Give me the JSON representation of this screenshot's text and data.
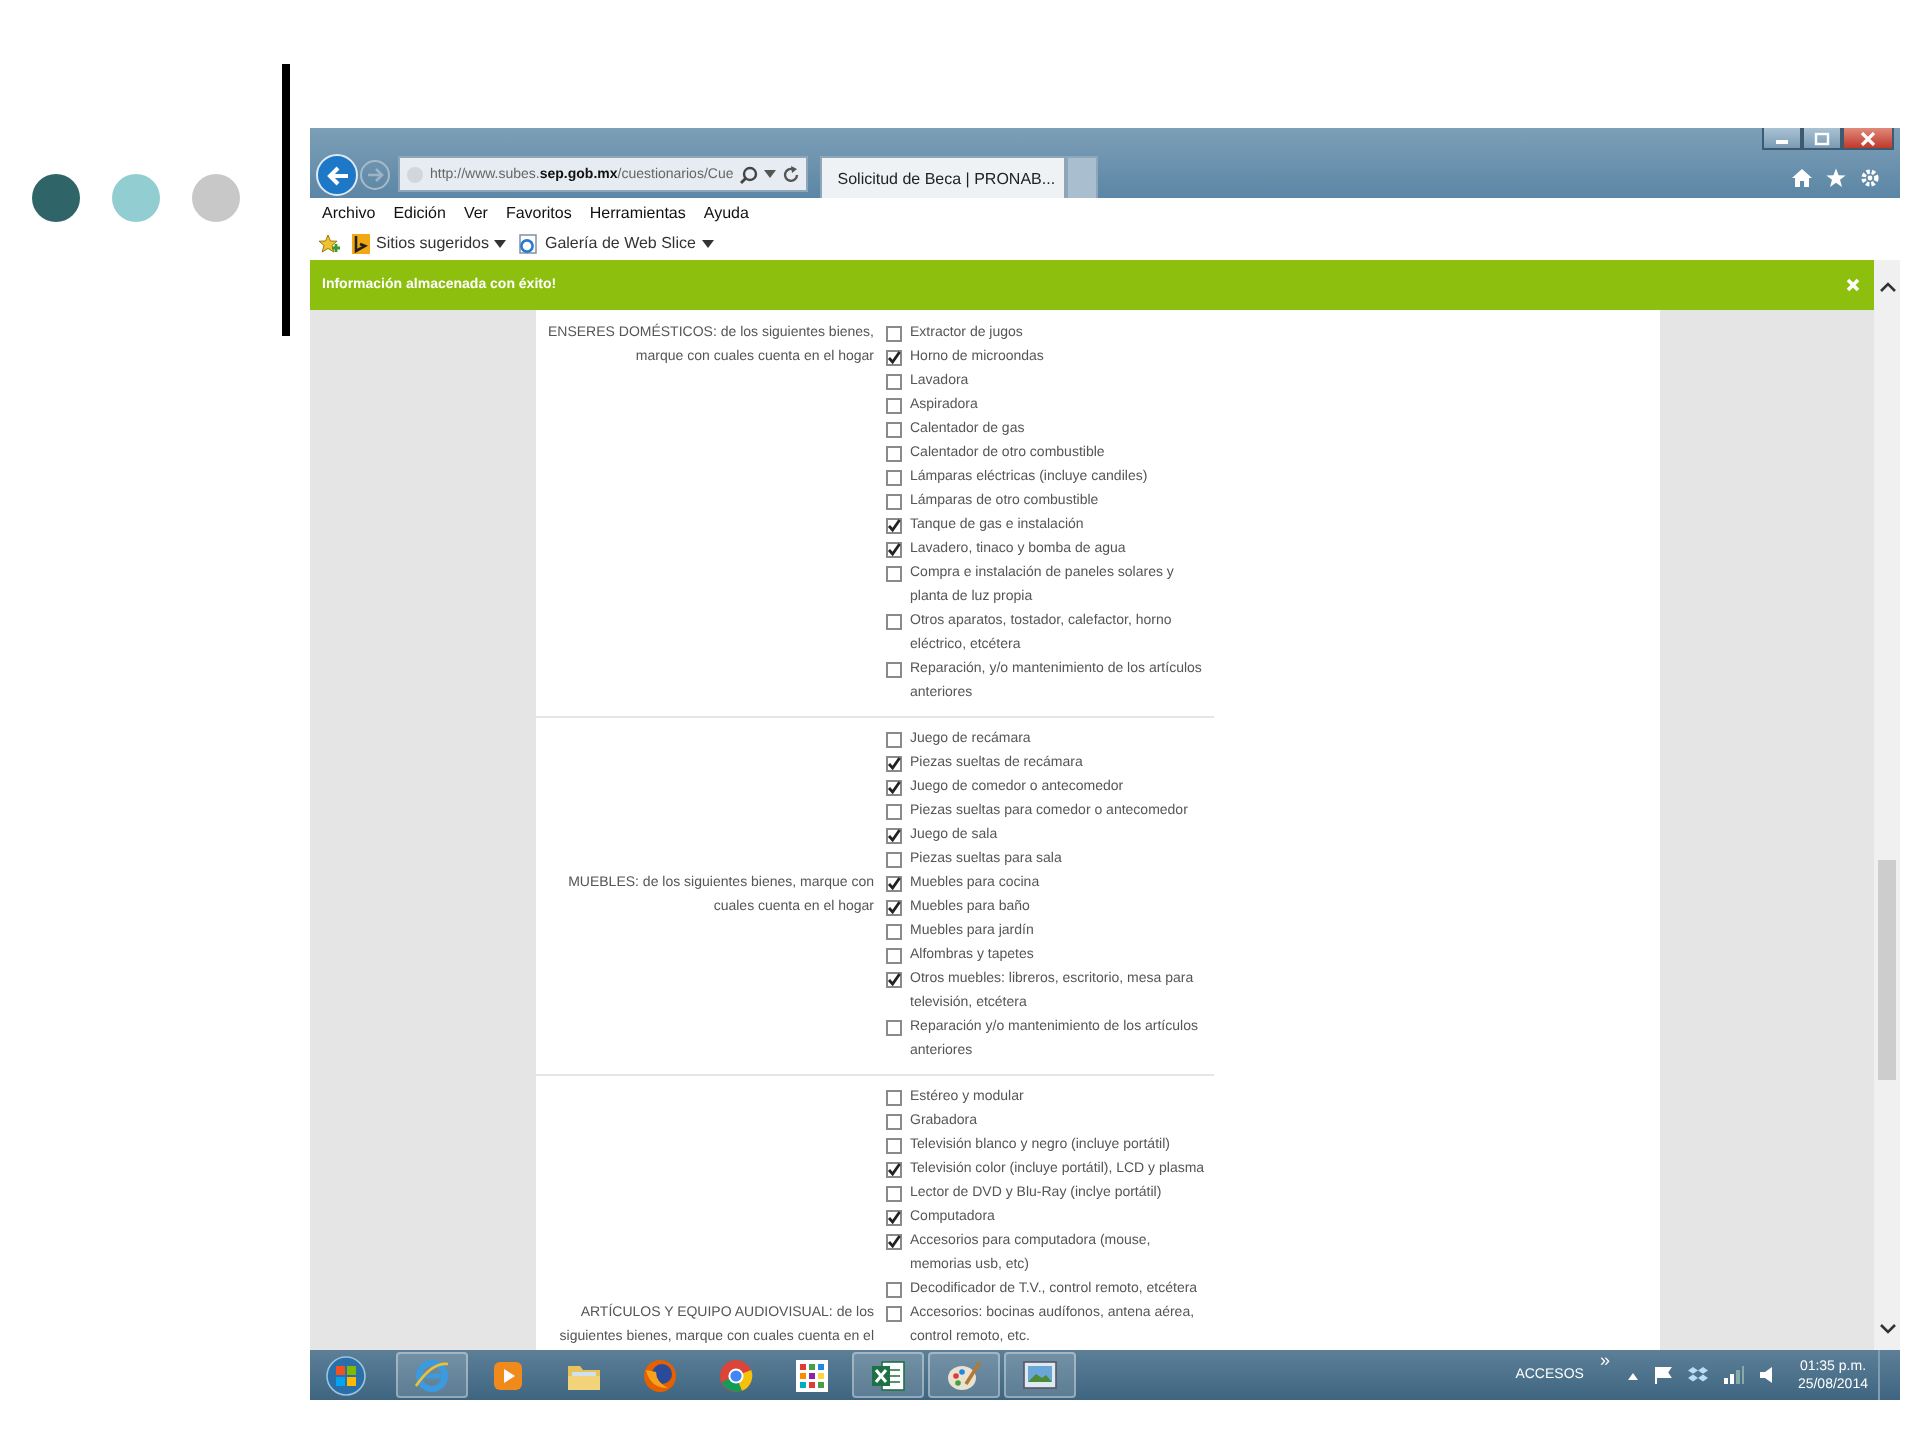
{
  "browser": {
    "address": "http://www.subes.**sep.gob.mx**/cuestionarios/Cue",
    "tabs": [
      {
        "title": "Solicitud de Beca | PRONAB...",
        "selected": true
      }
    ],
    "menu": [
      "Archivo",
      "Edición",
      "Ver",
      "Favoritos",
      "Herramientas",
      "Ayuda"
    ],
    "favorites": [
      {
        "kind": "suggested",
        "label": "Sitios sugeridos"
      },
      {
        "kind": "webslice",
        "label": "Galería de Web Slice"
      }
    ],
    "notification": {
      "text": "Información almacenada con éxito!"
    }
  },
  "form": {
    "sections": [
      {
        "label": "ENSERES DOMÉSTICOS: de los siguientes bienes, marque con cuales cuenta en el hogar",
        "items": [
          {
            "label": "Extractor de jugos",
            "checked": false
          },
          {
            "label": "Horno de microondas",
            "checked": true
          },
          {
            "label": "Lavadora",
            "checked": false
          },
          {
            "label": "Aspiradora",
            "checked": false
          },
          {
            "label": "Calentador de gas",
            "checked": false
          },
          {
            "label": "Calentador de otro combustible",
            "checked": false
          },
          {
            "label": "Lámparas eléctricas (incluye candiles)",
            "checked": false
          },
          {
            "label": "Lámparas de otro combustible",
            "checked": false
          },
          {
            "label": "Tanque de gas e instalación",
            "checked": true
          },
          {
            "label": "Lavadero, tinaco y bomba de agua",
            "checked": true
          },
          {
            "label": "Compra e instalación de paneles solares y planta de luz propia",
            "checked": false
          },
          {
            "label": "Otros aparatos, tostador, calefactor, horno eléctrico, etcétera",
            "checked": false
          },
          {
            "label": "Reparación, y/o mantenimiento de los artículos anteriores",
            "checked": false
          }
        ]
      },
      {
        "label": "MUEBLES: de los siguientes bienes, marque con cuales cuenta en el hogar",
        "items": [
          {
            "label": "Juego de recámara",
            "checked": false
          },
          {
            "label": "Piezas sueltas de recámara",
            "checked": true
          },
          {
            "label": "Juego de comedor o antecomedor",
            "checked": true
          },
          {
            "label": "Piezas sueltas para comedor o antecomedor",
            "checked": false
          },
          {
            "label": "Juego de sala",
            "checked": true
          },
          {
            "label": "Piezas sueltas para sala",
            "checked": false
          },
          {
            "label": "Muebles para cocina",
            "checked": true
          },
          {
            "label": "Muebles para baño",
            "checked": true
          },
          {
            "label": "Muebles para jardín",
            "checked": false
          },
          {
            "label": "Alfombras y tapetes",
            "checked": false
          },
          {
            "label": "Otros muebles: libreros, escritorio, mesa para televisión, etcétera",
            "checked": true
          },
          {
            "label": "Reparación y/o mantenimiento de los artículos anteriores",
            "checked": false
          }
        ]
      },
      {
        "label": "ARTÍCULOS Y EQUIPO AUDIOVISUAL: de los siguientes bienes, marque con cuales cuenta en el",
        "items": [
          {
            "label": "Estéreo y modular",
            "checked": false
          },
          {
            "label": "Grabadora",
            "checked": false
          },
          {
            "label": "Televisión blanco y negro (incluye portátil)",
            "checked": false
          },
          {
            "label": "Televisión color (incluye portátil), LCD y plasma",
            "checked": true
          },
          {
            "label": "Lector de DVD y Blu-Ray (inclye portátil)",
            "checked": false
          },
          {
            "label": "Computadora",
            "checked": true
          },
          {
            "label": "Accesorios para computadora (mouse, memorias usb, etc)",
            "checked": true
          },
          {
            "label": "Decodificador de T.V., control remoto, etcétera",
            "checked": false
          },
          {
            "label": "Accesorios: bocinas audífonos, antena aérea, control remoto, etc.",
            "checked": false
          }
        ]
      }
    ]
  },
  "taskbar": {
    "apps": [
      {
        "kind": "ie",
        "open": true
      },
      {
        "kind": "media",
        "open": false
      },
      {
        "kind": "folder",
        "open": false
      },
      {
        "kind": "firefox",
        "open": false
      },
      {
        "kind": "chrome",
        "open": false
      },
      {
        "kind": "apps",
        "open": false
      },
      {
        "kind": "excel",
        "open": true
      },
      {
        "kind": "paint",
        "open": true
      },
      {
        "kind": "photo",
        "open": true
      }
    ],
    "accesos": "ACCESOS",
    "chevron": "»",
    "time": "01:35 p.m.",
    "date": "25/08/2014"
  }
}
